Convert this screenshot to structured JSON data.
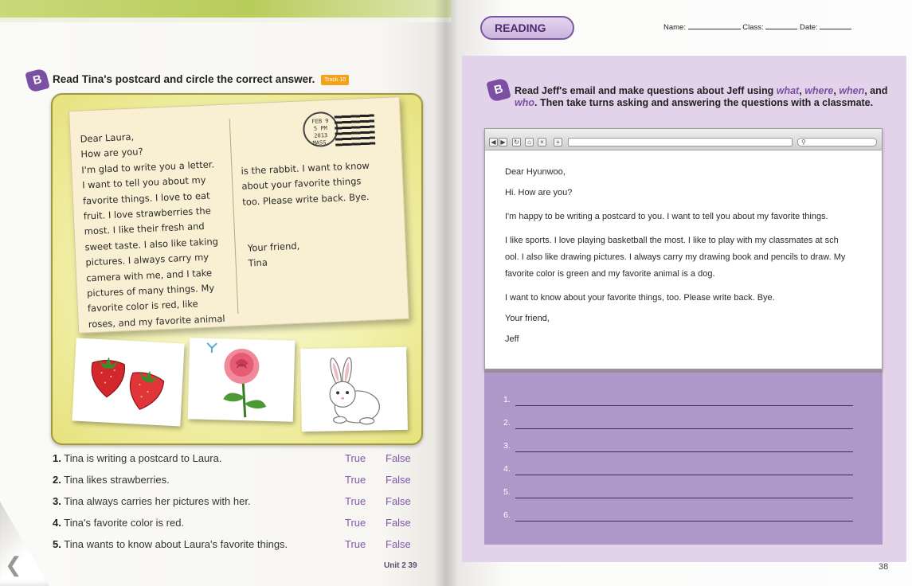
{
  "left_page": {
    "section_letter": "B",
    "instruction": "Read Tina's postcard and circle the correct answer.",
    "track_label": "Track 10",
    "postcard": {
      "left_text": "Dear Laura,\nHow are you?\nI'm glad to write you a letter.\nI want to tell you about my\nfavorite things. I love to eat\nfruit. I love strawberries the\nmost. I like their fresh and\nsweet taste. I also like taking\npictures. I always carry my\ncamera with me, and I take\npictures of many things. My\nfavorite color is red, like\nroses, and my favorite animal",
      "right_text": "is the rabbit. I want to know\nabout your favorite things\ntoo. Please write back. Bye.",
      "signoff": "Your friend,\nTina",
      "stamp_text": "FEB 9\n5 PM\n2013\nMASS."
    },
    "photos": [
      "strawberries",
      "rose",
      "rabbit"
    ],
    "questions": [
      {
        "num": "1.",
        "text": "Tina is writing a postcard to Laura.",
        "true_label": "True",
        "false_label": "False"
      },
      {
        "num": "2.",
        "text": "Tina likes strawberries.",
        "true_label": "True",
        "false_label": "False"
      },
      {
        "num": "3.",
        "text": "Tina always carries her pictures with her.",
        "true_label": "True",
        "false_label": "False"
      },
      {
        "num": "4.",
        "text": "Tina's favorite color is red.",
        "true_label": "True",
        "false_label": "False"
      },
      {
        "num": "5.",
        "text": "Tina wants to know about Laura's favorite things.",
        "true_label": "True",
        "false_label": "False"
      }
    ],
    "page_footer": "Unit 2 39"
  },
  "right_page": {
    "section_tag": "READING",
    "header": {
      "name_label": "Name:",
      "class_label": "Class:",
      "date_label": "Date:"
    },
    "section_letter": "B",
    "instruction_start": "Read Jeff's email and make questions about Jeff using ",
    "kw_what": "what",
    "sep1": ", ",
    "kw_where": "where",
    "sep2": ", ",
    "kw_when": "when",
    "sep3": ", and ",
    "kw_who": "who",
    "instruction_end": ". Then take turns asking and answering the questions with a classmate.",
    "browser": {
      "search_icon": "search-icon",
      "email_lines": [
        "Dear Hyunwoo,",
        "Hi. How are you?",
        "I'm happy to be writing a postcard to you. I want to tell you about my favorite things.",
        "I like sports. I love playing basketball the most. I like to play with my classmates at     sch",
        "ool. I also like drawing pictures. I always carry my drawing book and pencils to draw. My",
        "favorite color is green and my favorite animal is a dog.",
        "I want to know about your favorite things, too. Please write back. Bye.",
        "Your friend,",
        "Jeff"
      ]
    },
    "answer_numbers": [
      "1.",
      "2.",
      "3.",
      "4.",
      "5.",
      "6."
    ],
    "page_number": "38"
  },
  "colors": {
    "purple_accent": "#7b4fa2",
    "lavender_panel": "#e3d3ea",
    "answer_panel": "#ae97c9",
    "yellow_panel": "#f2f0ac",
    "green_strip": "#b8cc5a"
  }
}
